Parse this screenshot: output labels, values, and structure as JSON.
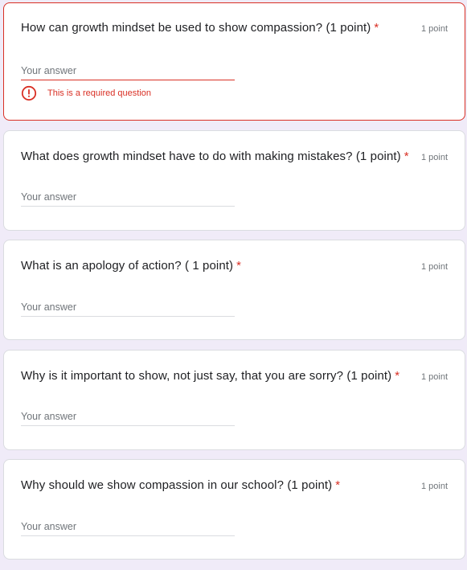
{
  "form": {
    "placeholder": "Your answer",
    "required_mark": "*",
    "error_message": "This is a required question",
    "questions": [
      {
        "title": "How can growth mindset be used to show compassion? (1 point)",
        "points": "1 point"
      },
      {
        "title": "What does growth mindset have to do with making mistakes? (1 point)",
        "points": "1 point"
      },
      {
        "title": "What is an apology of action? ( 1 point)",
        "points": "1 point"
      },
      {
        "title": "Why is it important to show, not just say, that you are sorry? (1 point)",
        "points": "1 point"
      },
      {
        "title": "Why should we show compassion in our school? (1 point)",
        "points": "1 point"
      }
    ]
  },
  "colors": {
    "background": "#f0ebf8",
    "error": "#d93025",
    "card_border": "#dadce0"
  },
  "icons": {
    "error": "error-circle-icon"
  }
}
